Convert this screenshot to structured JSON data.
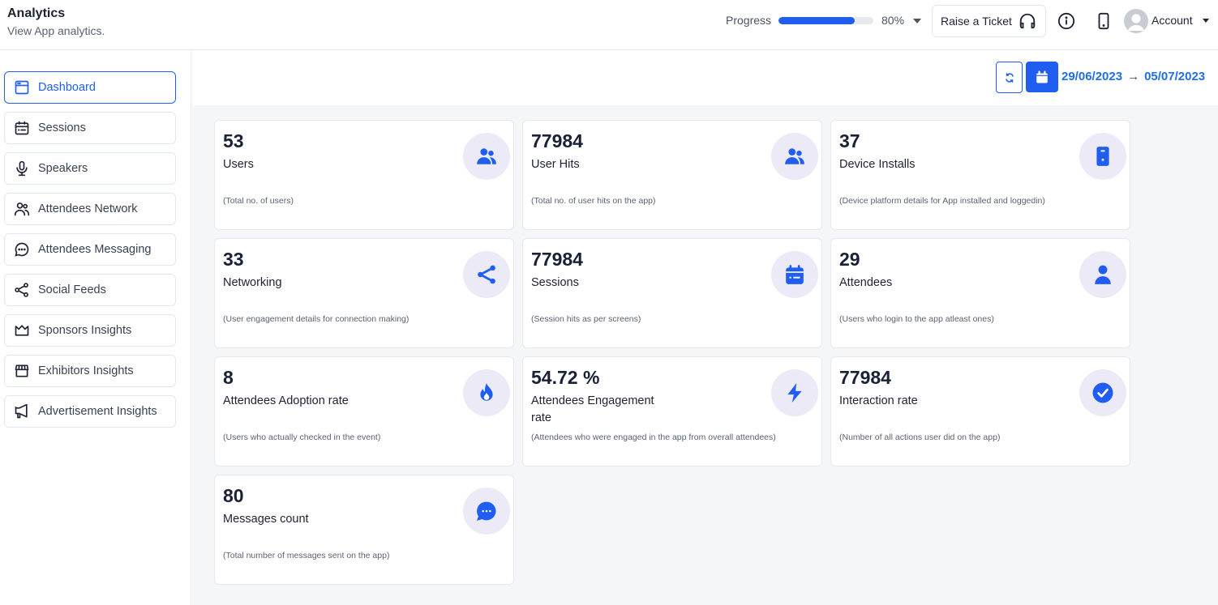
{
  "header": {
    "title": "Analytics",
    "subtitle": "View App analytics.",
    "progress": {
      "label": "Progress",
      "percent": 80,
      "display": "80%"
    },
    "raise_ticket_label": "Raise a Ticket",
    "account_label": "Account"
  },
  "sidebar": {
    "items": [
      {
        "label": "Dashboard",
        "icon": "browser-window-icon",
        "active": true
      },
      {
        "label": "Sessions",
        "icon": "calendar-icon",
        "active": false
      },
      {
        "label": "Speakers",
        "icon": "microphone-icon",
        "active": false
      },
      {
        "label": "Attendees Network",
        "icon": "users-icon",
        "active": false
      },
      {
        "label": "Attendees Messaging",
        "icon": "chat-bubble-icon",
        "active": false
      },
      {
        "label": "Social Feeds",
        "icon": "share-icon",
        "active": false
      },
      {
        "label": "Sponsors Insights",
        "icon": "crown-icon",
        "active": false
      },
      {
        "label": "Exhibitors Insights",
        "icon": "storefront-icon",
        "active": false
      },
      {
        "label": "Advertisement Insights",
        "icon": "megaphone-icon",
        "active": false
      }
    ]
  },
  "date_range": {
    "start": "29/06/2023",
    "arrow": "→",
    "end": "05/07/2023"
  },
  "colors": {
    "accent": "#1f5ef0",
    "icon_bg": "#eceaf7",
    "text_dark": "#1a2036"
  },
  "cards": [
    {
      "value": "53",
      "label": "Users",
      "desc": "(Total no. of users)",
      "icon": "users-icon"
    },
    {
      "value": "77984",
      "label": "User Hits",
      "desc": "(Total no. of user hits on the app)",
      "icon": "users-icon"
    },
    {
      "value": "37",
      "label": "Device Installs",
      "desc": "(Device platform details for App installed and loggedin)",
      "icon": "mobile-device-icon"
    },
    {
      "value": "33",
      "label": "Networking",
      "desc": "(User engagement details for connection making)",
      "icon": "share-icon"
    },
    {
      "value": "77984",
      "label": "Sessions",
      "desc": "(Session hits as per screens)",
      "icon": "calendar-icon"
    },
    {
      "value": "29",
      "label": "Attendees",
      "desc": "(Users who login to the app atleast ones)",
      "icon": "user-icon"
    },
    {
      "value": "8",
      "label": "Attendees Adoption rate",
      "desc": "(Users who actually checked in the event)",
      "icon": "fire-icon"
    },
    {
      "value": "54.72 %",
      "label": "Attendees Engagement rate",
      "desc": "(Attendees who were engaged in the app from overall attendees)",
      "icon": "lightning-icon"
    },
    {
      "value": "77984",
      "label": "Interaction rate",
      "desc": "(Number of all actions user did on the app)",
      "icon": "check-circle-icon"
    },
    {
      "value": "80",
      "label": "Messages count",
      "desc": "(Total number of messages sent on the app)",
      "icon": "chat-bubble-icon"
    }
  ]
}
